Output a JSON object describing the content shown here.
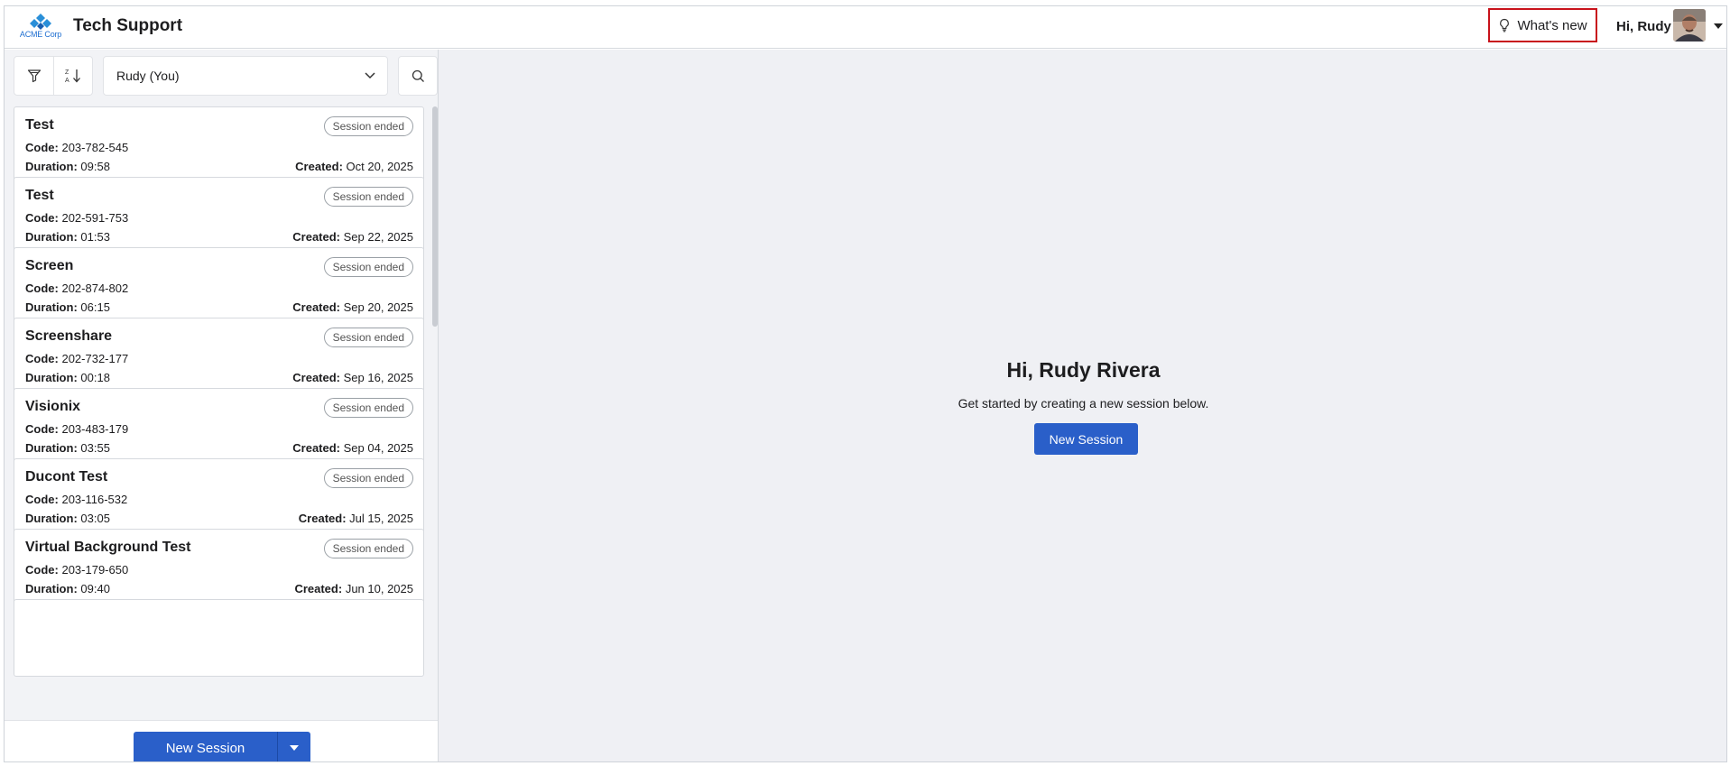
{
  "header": {
    "logo_text": "ACME Corp",
    "app_title": "Tech Support",
    "whats_new_label": "What's new",
    "greeting": "Hi, Rudy"
  },
  "toolbar": {
    "filter_icon": "filter-icon",
    "sort_icon": "sort-az-icon",
    "user_filter_value": "Rudy (You)",
    "search_icon": "search-icon"
  },
  "sessions": [
    {
      "name": "Test",
      "status": "Session ended",
      "code_label": "Code:",
      "code": "203-782-545",
      "duration_label": "Duration:",
      "duration": "09:58",
      "created_label": "Created:",
      "created": "Oct 20, 2025"
    },
    {
      "name": "Test",
      "status": "Session ended",
      "code_label": "Code:",
      "code": "202-591-753",
      "duration_label": "Duration:",
      "duration": "01:53",
      "created_label": "Created:",
      "created": "Sep 22, 2025"
    },
    {
      "name": "Screen",
      "status": "Session ended",
      "code_label": "Code:",
      "code": "202-874-802",
      "duration_label": "Duration:",
      "duration": "06:15",
      "created_label": "Created:",
      "created": "Sep 20, 2025"
    },
    {
      "name": "Screenshare",
      "status": "Session ended",
      "code_label": "Code:",
      "code": "202-732-177",
      "duration_label": "Duration:",
      "duration": "00:18",
      "created_label": "Created:",
      "created": "Sep 16, 2025"
    },
    {
      "name": "Visionix",
      "status": "Session ended",
      "code_label": "Code:",
      "code": "203-483-179",
      "duration_label": "Duration:",
      "duration": "03:55",
      "created_label": "Created:",
      "created": "Sep 04, 2025"
    },
    {
      "name": "Ducont Test",
      "status": "Session ended",
      "code_label": "Code:",
      "code": "203-116-532",
      "duration_label": "Duration:",
      "duration": "03:05",
      "created_label": "Created:",
      "created": "Jul 15, 2025"
    },
    {
      "name": "Virtual Background Test",
      "status": "Session ended",
      "code_label": "Code:",
      "code": "203-179-650",
      "duration_label": "Duration:",
      "duration": "09:40",
      "created_label": "Created:",
      "created": "Jun 10, 2025"
    }
  ],
  "footer": {
    "new_session_label": "New Session"
  },
  "main": {
    "title": "Hi, Rudy Rivera",
    "subtitle": "Get started by creating a new session below.",
    "new_session_label": "New Session"
  },
  "colors": {
    "primary": "#2a5fc9",
    "highlight_border": "#c8121b",
    "main_bg": "#eff0f4",
    "panel_bg": "#f2f3f6"
  }
}
